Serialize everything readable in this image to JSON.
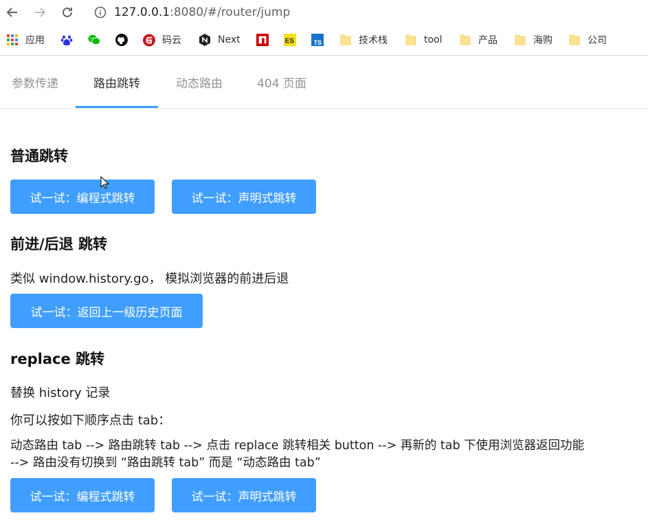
{
  "browser": {
    "url_host": "127.0.0.1",
    "url_rest": ":8080/#/router/jump",
    "bookmarks": [
      {
        "label": "应用",
        "icon": "apps-grid-icon"
      },
      {
        "label": "",
        "icon": "baidu-paw-icon"
      },
      {
        "label": "",
        "icon": "wechat-icon"
      },
      {
        "label": "",
        "icon": "github-icon"
      },
      {
        "label": "码云",
        "icon": "gitee-icon"
      },
      {
        "label": "Next",
        "icon": "next-icon"
      },
      {
        "label": "",
        "icon": "npm-icon"
      },
      {
        "label": "",
        "icon": "es-icon"
      },
      {
        "label": "",
        "icon": "ts-icon"
      },
      {
        "label": "技术栈",
        "icon": "folder-icon"
      },
      {
        "label": "tool",
        "icon": "folder-icon"
      },
      {
        "label": "产品",
        "icon": "folder-icon"
      },
      {
        "label": "海购",
        "icon": "folder-icon"
      },
      {
        "label": "公司",
        "icon": "folder-icon"
      }
    ]
  },
  "tabs": [
    {
      "label": "参数传递"
    },
    {
      "label": "路由跳转"
    },
    {
      "label": "动态路由"
    },
    {
      "label": "404 页面"
    }
  ],
  "sections": {
    "normal": {
      "title": "普通跳转",
      "btn_programmatic": "试一试：编程式跳转",
      "btn_declarative": "试一试：声明式跳转"
    },
    "history": {
      "title": "前进/后退 跳转",
      "desc": "类似 window.history.go， 模拟浏览器的前进后退",
      "btn_back": "试一试：返回上一级历史页面"
    },
    "replace": {
      "title": "replace 跳转",
      "desc1": "替换 history 记录",
      "desc2": "你可以按如下顺序点击 tab：",
      "desc3_line1": "动态路由 tab --> 路由跳转 tab --> 点击 replace 跳转相关 button --> 再新的 tab 下使用浏览器返回功能",
      "desc3_line2": "--> 路由没有切换到 “路由跳转 tab” 而是 “动态路由 tab”",
      "btn_programmatic": "试一试：编程式跳转",
      "btn_declarative": "试一试：声明式跳转"
    }
  },
  "colors": {
    "primary": "#409eff",
    "tab_active_text": "#303133",
    "tab_text": "#909399"
  }
}
